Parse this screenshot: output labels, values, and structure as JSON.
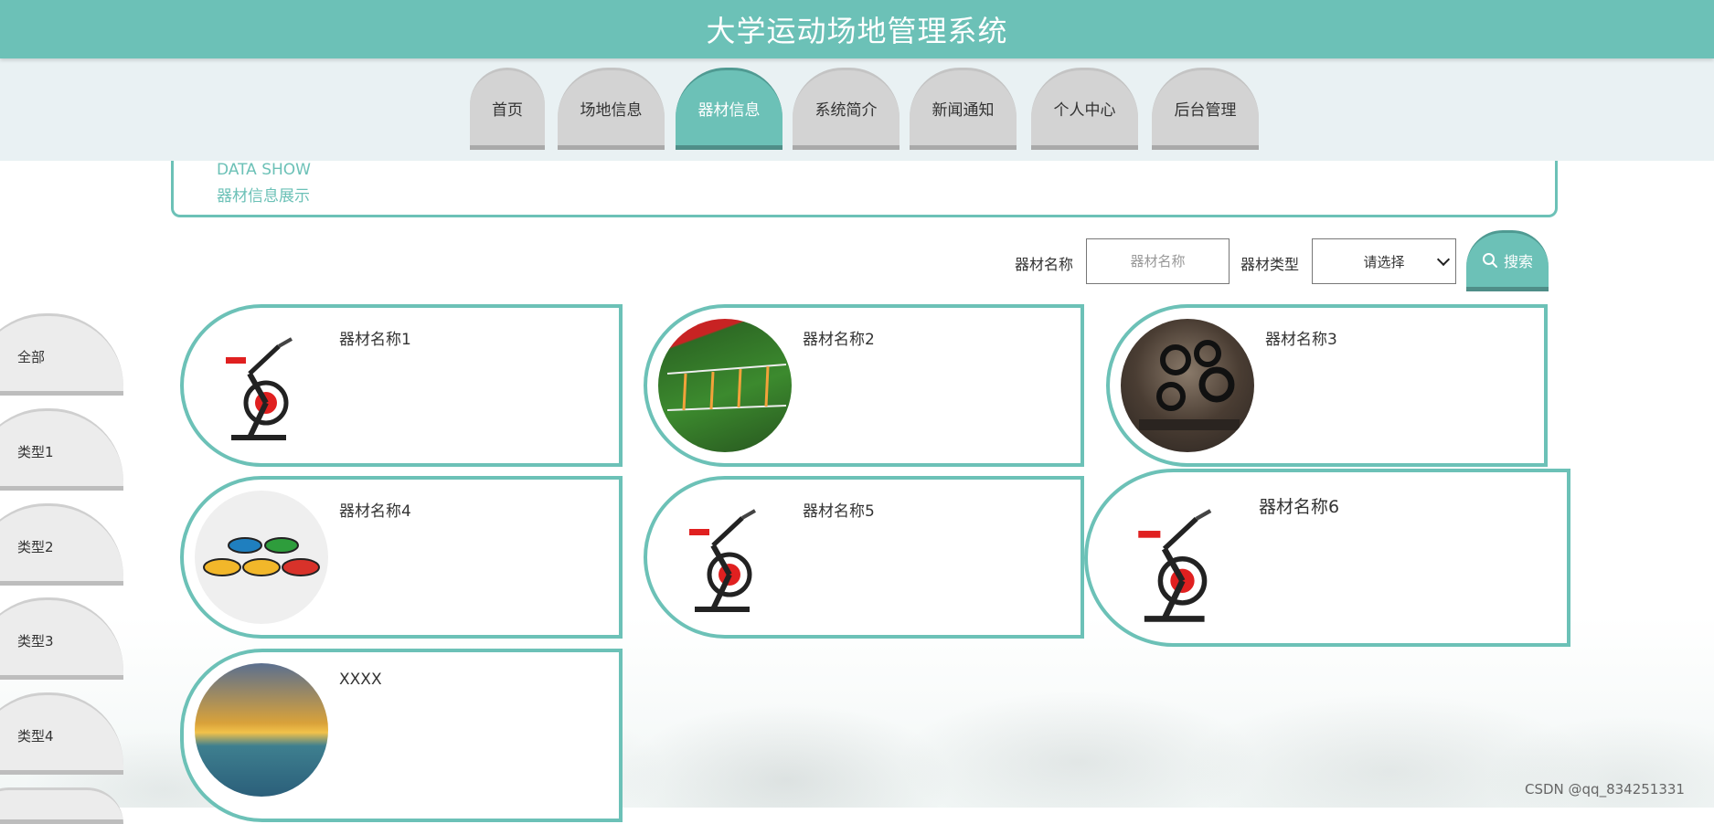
{
  "app": {
    "title": "大学运动场地管理系统"
  },
  "nav": {
    "tabs": [
      {
        "label": "首页",
        "active": false
      },
      {
        "label": "场地信息",
        "active": false
      },
      {
        "label": "器材信息",
        "active": true
      },
      {
        "label": "系统简介",
        "active": false
      },
      {
        "label": "新闻通知",
        "active": false
      },
      {
        "label": "个人中心",
        "active": false
      },
      {
        "label": "后台管理",
        "active": false
      }
    ]
  },
  "section": {
    "en_title": "DATA SHOW",
    "zh_title": "器材信息展示"
  },
  "search": {
    "name_label": "器材名称",
    "name_placeholder": "器材名称",
    "type_label": "器材类型",
    "type_selected": "请选择",
    "button_label": "搜索"
  },
  "categories": [
    {
      "label": "全部"
    },
    {
      "label": "类型1"
    },
    {
      "label": "类型2"
    },
    {
      "label": "类型3"
    },
    {
      "label": "类型4"
    }
  ],
  "items": [
    {
      "name": "器材名称1",
      "image": "spin-bike"
    },
    {
      "name": "器材名称2",
      "image": "agility-ladder"
    },
    {
      "name": "器材名称3",
      "image": "gym-tires"
    },
    {
      "name": "器材名称4",
      "image": "floor-spot-markers"
    },
    {
      "name": "器材名称5",
      "image": "spin-bike"
    },
    {
      "name": "器材名称6",
      "image": "spin-bike"
    },
    {
      "name": "XXXX",
      "image": "seaside-sunset"
    }
  ],
  "watermark": "CSDN @qq_834251331",
  "colors": {
    "accent": "#6cc1b7",
    "tab_inactive": "#d3d3d3",
    "category_bg": "#ececec"
  }
}
